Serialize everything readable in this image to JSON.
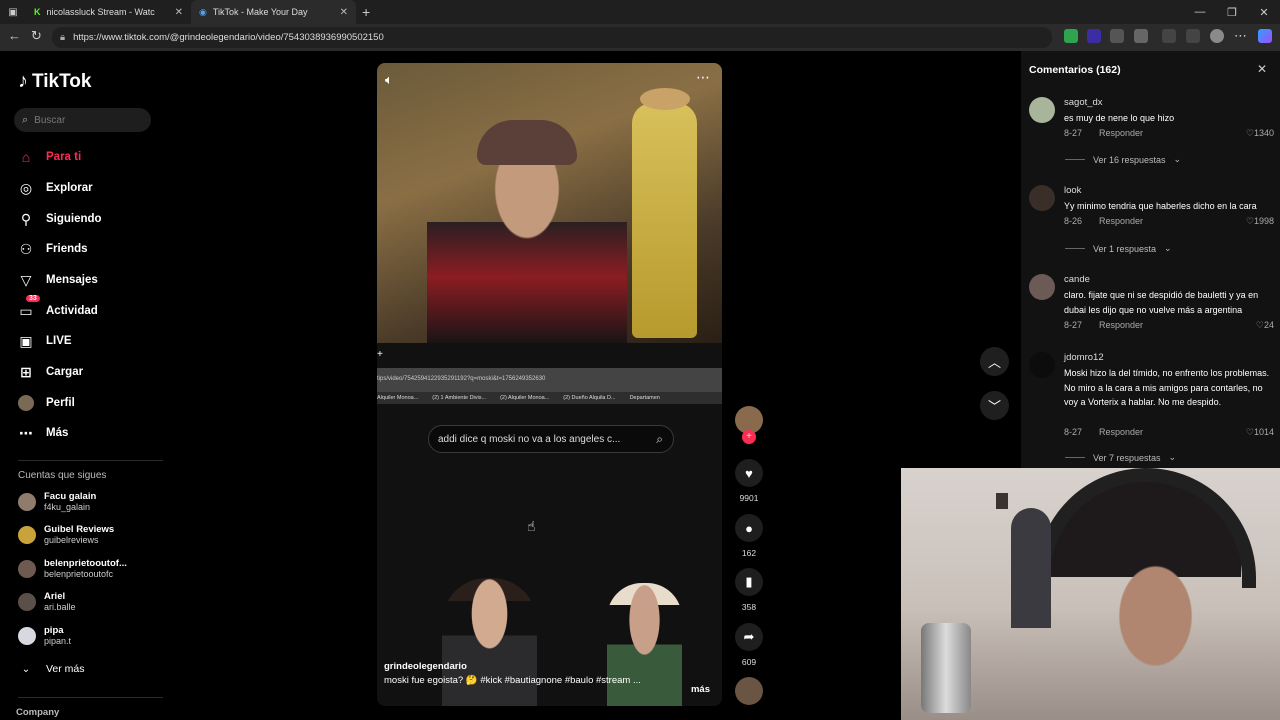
{
  "browser": {
    "tabs": [
      {
        "label": "nicolassluck Stream - Watch",
        "active": false
      },
      {
        "label": "TikTok - Make Your Day",
        "active": true
      }
    ],
    "url": "https://www.tiktok.com/@grindeolegendario/video/7543038936990502150"
  },
  "brand": {
    "name": "TikTok"
  },
  "search": {
    "placeholder": "Buscar"
  },
  "nav": [
    {
      "label": "Para ti",
      "icon": "home-icon",
      "active": true
    },
    {
      "label": "Explorar",
      "icon": "compass-icon"
    },
    {
      "label": "Siguiendo",
      "icon": "following-icon"
    },
    {
      "label": "Friends",
      "icon": "friends-icon"
    },
    {
      "label": "Mensajes",
      "icon": "messages-icon"
    },
    {
      "label": "Actividad",
      "icon": "activity-icon",
      "badge": "33"
    },
    {
      "label": "LIVE",
      "icon": "live-icon"
    },
    {
      "label": "Cargar",
      "icon": "upload-icon"
    },
    {
      "label": "Perfil",
      "icon": "profile-avatar"
    },
    {
      "label": "Más",
      "icon": "more-icon"
    }
  ],
  "following": {
    "title": "Cuentas que sigues",
    "accounts": [
      {
        "name": "Facu galain",
        "handle": "f4ku_galain"
      },
      {
        "name": "Guibel Reviews",
        "handle": "guibelreviews"
      },
      {
        "name": "belenprietooutof...",
        "handle": "belenprietooutofc"
      },
      {
        "name": "Ariel",
        "handle": "ari.balle"
      },
      {
        "name": "pipa",
        "handle": "pipan.t"
      }
    ],
    "see_more": "Ver más"
  },
  "footer": {
    "company": "Company"
  },
  "video": {
    "inner_url": "tips/video/7542594122935291192?q=moski&t=1756249352630",
    "bookmarks": [
      "Alquiler Monoa...",
      "(2) 1 Ambiente Divis...",
      "(2) Alquiler Monoa...",
      "(2) Dueño Alquila D...",
      "Departamen"
    ],
    "inner_search": "addi dice q moski no va a los angeles c...",
    "username": "grindeolegendario",
    "caption": "moski fue egoista? 🤔 #kick #bautiagnone #baulo #stream ...",
    "more_label": "más"
  },
  "actions": {
    "likes": "9901",
    "comments": "162",
    "saves": "358",
    "shares": "609"
  },
  "comments_panel": {
    "title": "Comentarios (162)",
    "items": [
      {
        "user": "sagot_dx",
        "text": "es muy de nene lo que hizo",
        "date": "8-27",
        "reply": "Responder",
        "likes": "1340",
        "more": "Ver 16 respuestas"
      },
      {
        "user": "look",
        "text": "Yy minimo tendria que haberles dicho en la cara",
        "date": "8-26",
        "reply": "Responder",
        "likes": "1998",
        "more": "Ver 1 respuesta"
      },
      {
        "user": "cande",
        "text": "claro. fijate que ni se despidió de bauletti y ya en dubai les dijo que no vuelve más a argentina",
        "date": "8-27",
        "reply": "Responder",
        "likes": "24"
      },
      {
        "user": "jdomro12",
        "text": "Moski hizo la del tímido, no enfrento los problemas. No miro a la cara a mis amigos para contarles, no voy a Vorterix a hablar. No me despido.",
        "date": "8-27",
        "reply": "Responder",
        "likes": "1014",
        "more": "Ver 7 respuestas"
      }
    ]
  }
}
